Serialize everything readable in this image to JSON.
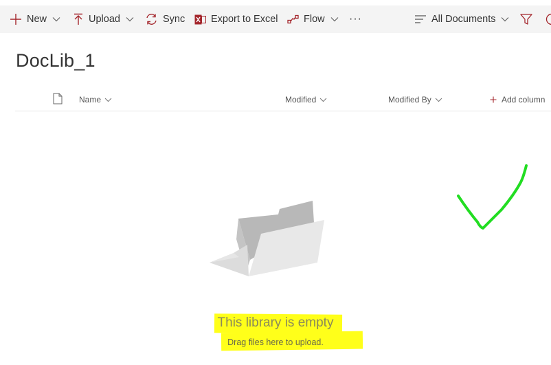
{
  "command_bar": {
    "new_label": "New",
    "upload_label": "Upload",
    "sync_label": "Sync",
    "export_label": "Export to Excel",
    "flow_label": "Flow",
    "more_label": "···",
    "view_label": "All Documents"
  },
  "library": {
    "title": "DocLib_1"
  },
  "columns": {
    "name": "Name",
    "modified": "Modified",
    "modified_by": "Modified By",
    "add_column": "Add column"
  },
  "empty_state": {
    "title": "This library is empty",
    "subtitle": "Drag files here to upload."
  },
  "colors": {
    "accent": "#a4262c",
    "highlight": "#ffff1a",
    "checkmark": "#22dd22",
    "command_bar_bg": "#f4f4f4"
  },
  "icons": [
    "plus-icon",
    "upload-icon",
    "sync-icon",
    "excel-icon",
    "flow-icon",
    "view-lines-icon",
    "filter-icon",
    "document-icon",
    "folder-illustration",
    "checkmark-annotation"
  ]
}
